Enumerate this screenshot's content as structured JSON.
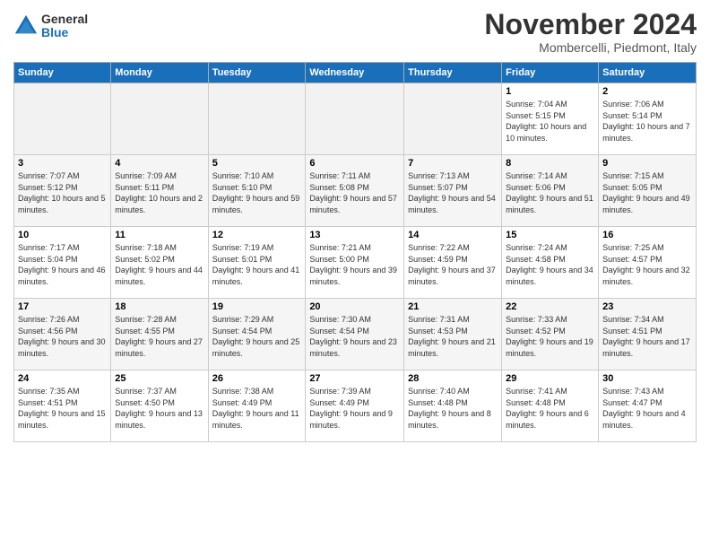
{
  "header": {
    "logo_general": "General",
    "logo_blue": "Blue",
    "month_title": "November 2024",
    "location": "Mombercelli, Piedmont, Italy"
  },
  "days_of_week": [
    "Sunday",
    "Monday",
    "Tuesday",
    "Wednesday",
    "Thursday",
    "Friday",
    "Saturday"
  ],
  "weeks": [
    [
      {
        "day": "",
        "info": ""
      },
      {
        "day": "",
        "info": ""
      },
      {
        "day": "",
        "info": ""
      },
      {
        "day": "",
        "info": ""
      },
      {
        "day": "",
        "info": ""
      },
      {
        "day": "1",
        "info": "Sunrise: 7:04 AM\nSunset: 5:15 PM\nDaylight: 10 hours and 10 minutes."
      },
      {
        "day": "2",
        "info": "Sunrise: 7:06 AM\nSunset: 5:14 PM\nDaylight: 10 hours and 7 minutes."
      }
    ],
    [
      {
        "day": "3",
        "info": "Sunrise: 7:07 AM\nSunset: 5:12 PM\nDaylight: 10 hours and 5 minutes."
      },
      {
        "day": "4",
        "info": "Sunrise: 7:09 AM\nSunset: 5:11 PM\nDaylight: 10 hours and 2 minutes."
      },
      {
        "day": "5",
        "info": "Sunrise: 7:10 AM\nSunset: 5:10 PM\nDaylight: 9 hours and 59 minutes."
      },
      {
        "day": "6",
        "info": "Sunrise: 7:11 AM\nSunset: 5:08 PM\nDaylight: 9 hours and 57 minutes."
      },
      {
        "day": "7",
        "info": "Sunrise: 7:13 AM\nSunset: 5:07 PM\nDaylight: 9 hours and 54 minutes."
      },
      {
        "day": "8",
        "info": "Sunrise: 7:14 AM\nSunset: 5:06 PM\nDaylight: 9 hours and 51 minutes."
      },
      {
        "day": "9",
        "info": "Sunrise: 7:15 AM\nSunset: 5:05 PM\nDaylight: 9 hours and 49 minutes."
      }
    ],
    [
      {
        "day": "10",
        "info": "Sunrise: 7:17 AM\nSunset: 5:04 PM\nDaylight: 9 hours and 46 minutes."
      },
      {
        "day": "11",
        "info": "Sunrise: 7:18 AM\nSunset: 5:02 PM\nDaylight: 9 hours and 44 minutes."
      },
      {
        "day": "12",
        "info": "Sunrise: 7:19 AM\nSunset: 5:01 PM\nDaylight: 9 hours and 41 minutes."
      },
      {
        "day": "13",
        "info": "Sunrise: 7:21 AM\nSunset: 5:00 PM\nDaylight: 9 hours and 39 minutes."
      },
      {
        "day": "14",
        "info": "Sunrise: 7:22 AM\nSunset: 4:59 PM\nDaylight: 9 hours and 37 minutes."
      },
      {
        "day": "15",
        "info": "Sunrise: 7:24 AM\nSunset: 4:58 PM\nDaylight: 9 hours and 34 minutes."
      },
      {
        "day": "16",
        "info": "Sunrise: 7:25 AM\nSunset: 4:57 PM\nDaylight: 9 hours and 32 minutes."
      }
    ],
    [
      {
        "day": "17",
        "info": "Sunrise: 7:26 AM\nSunset: 4:56 PM\nDaylight: 9 hours and 30 minutes."
      },
      {
        "day": "18",
        "info": "Sunrise: 7:28 AM\nSunset: 4:55 PM\nDaylight: 9 hours and 27 minutes."
      },
      {
        "day": "19",
        "info": "Sunrise: 7:29 AM\nSunset: 4:54 PM\nDaylight: 9 hours and 25 minutes."
      },
      {
        "day": "20",
        "info": "Sunrise: 7:30 AM\nSunset: 4:54 PM\nDaylight: 9 hours and 23 minutes."
      },
      {
        "day": "21",
        "info": "Sunrise: 7:31 AM\nSunset: 4:53 PM\nDaylight: 9 hours and 21 minutes."
      },
      {
        "day": "22",
        "info": "Sunrise: 7:33 AM\nSunset: 4:52 PM\nDaylight: 9 hours and 19 minutes."
      },
      {
        "day": "23",
        "info": "Sunrise: 7:34 AM\nSunset: 4:51 PM\nDaylight: 9 hours and 17 minutes."
      }
    ],
    [
      {
        "day": "24",
        "info": "Sunrise: 7:35 AM\nSunset: 4:51 PM\nDaylight: 9 hours and 15 minutes."
      },
      {
        "day": "25",
        "info": "Sunrise: 7:37 AM\nSunset: 4:50 PM\nDaylight: 9 hours and 13 minutes."
      },
      {
        "day": "26",
        "info": "Sunrise: 7:38 AM\nSunset: 4:49 PM\nDaylight: 9 hours and 11 minutes."
      },
      {
        "day": "27",
        "info": "Sunrise: 7:39 AM\nSunset: 4:49 PM\nDaylight: 9 hours and 9 minutes."
      },
      {
        "day": "28",
        "info": "Sunrise: 7:40 AM\nSunset: 4:48 PM\nDaylight: 9 hours and 8 minutes."
      },
      {
        "day": "29",
        "info": "Sunrise: 7:41 AM\nSunset: 4:48 PM\nDaylight: 9 hours and 6 minutes."
      },
      {
        "day": "30",
        "info": "Sunrise: 7:43 AM\nSunset: 4:47 PM\nDaylight: 9 hours and 4 minutes."
      }
    ]
  ]
}
